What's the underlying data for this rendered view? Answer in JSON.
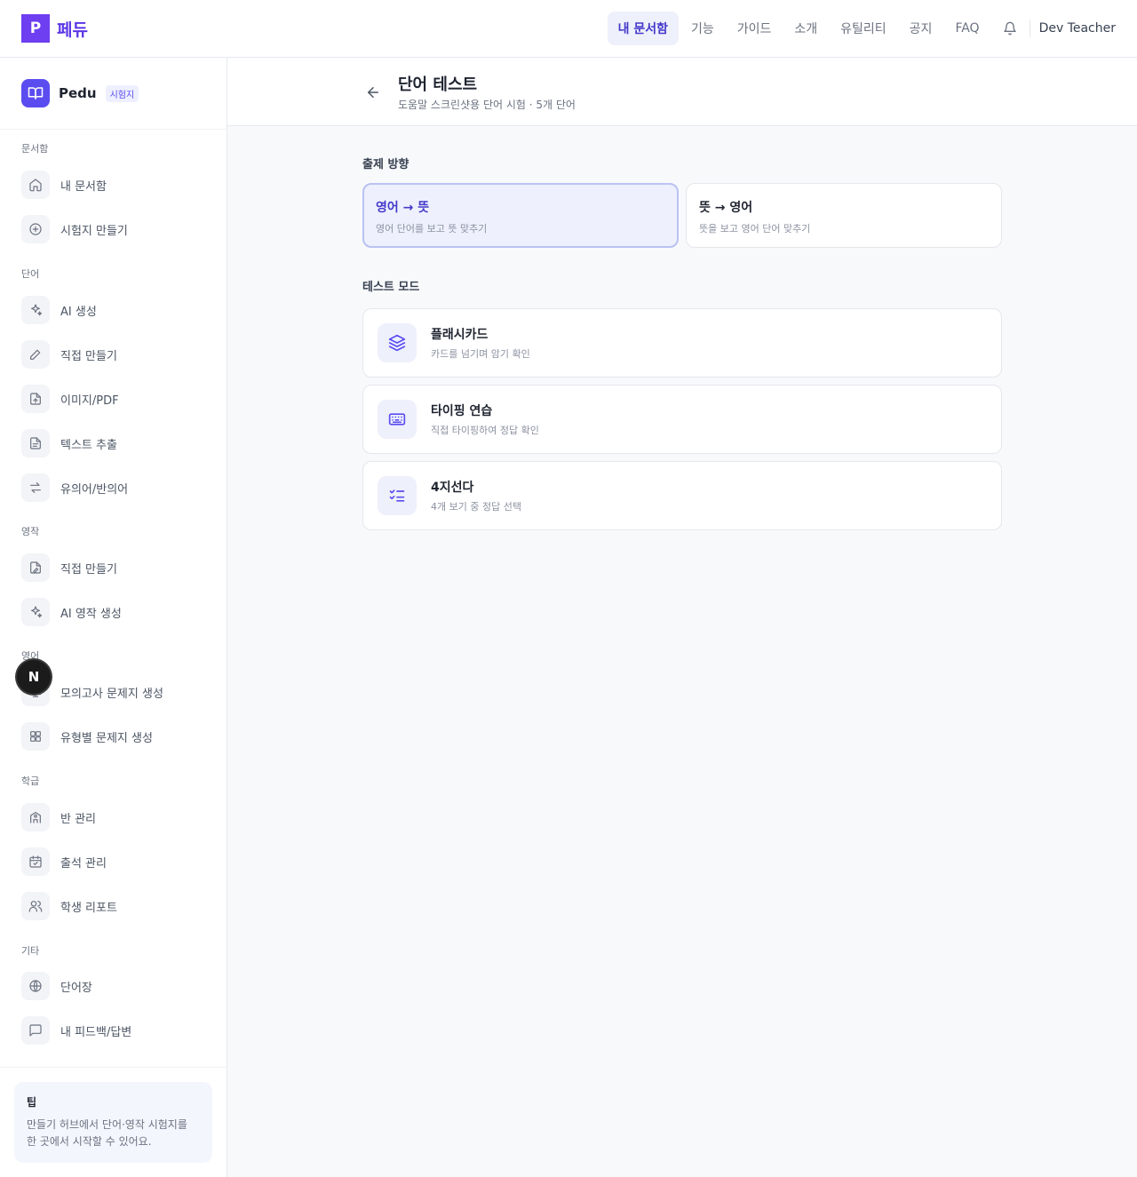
{
  "topbar": {
    "logo_letter": "P",
    "brand": "페듀",
    "nav": [
      "내 문서함",
      "기능",
      "가이드",
      "소개",
      "유틸리티",
      "공지",
      "FAQ"
    ],
    "user": "Dev Teacher"
  },
  "sidebar": {
    "brand_name": "Pedu",
    "brand_badge": "시험지",
    "sections": [
      {
        "title": "문서함",
        "items": [
          {
            "label": "내 문서함",
            "icon": "home-icon"
          },
          {
            "label": "시험지 만들기",
            "icon": "plus-circle-icon"
          }
        ]
      },
      {
        "title": "단어",
        "items": [
          {
            "label": "AI 생성",
            "icon": "sparkle-icon"
          },
          {
            "label": "직접 만들기",
            "icon": "pencil-icon"
          },
          {
            "label": "이미지/PDF",
            "icon": "file-upload-icon"
          },
          {
            "label": "텍스트 추출",
            "icon": "file-text-icon"
          },
          {
            "label": "유의어/반의어",
            "icon": "swap-icon"
          }
        ]
      },
      {
        "title": "영작",
        "items": [
          {
            "label": "직접 만들기",
            "icon": "file-edit-icon"
          },
          {
            "label": "AI 영작 생성",
            "icon": "sparkle-icon"
          }
        ]
      },
      {
        "title": "영어",
        "items": [
          {
            "label": "모의고사 문제지 생성",
            "icon": "monitor-icon"
          },
          {
            "label": "유형별 문제지 생성",
            "icon": "grid-icon"
          }
        ]
      },
      {
        "title": "학급",
        "items": [
          {
            "label": "반 관리",
            "icon": "school-icon"
          },
          {
            "label": "출석 관리",
            "icon": "calendar-check-icon"
          },
          {
            "label": "학생 리포트",
            "icon": "users-icon"
          }
        ]
      },
      {
        "title": "기타",
        "items": [
          {
            "label": "단어장",
            "icon": "globe-icon"
          },
          {
            "label": "내 피드백/답변",
            "icon": "message-icon"
          }
        ]
      }
    ],
    "tip": {
      "title": "팁",
      "body": "만들기 허브에서 단어·영작 시험지를 한 곳에서 시작할 수 있어요."
    },
    "float_letter": "N"
  },
  "header": {
    "title": "단어 테스트",
    "subtitle": "도움말 스크린샷용 단어 시험 · 5개 단어"
  },
  "direction": {
    "title": "출제 방향",
    "options": [
      {
        "title": "영어 → 뜻",
        "desc": "영어 단어를 보고 뜻 맞추기",
        "selected": true
      },
      {
        "title": "뜻 → 영어",
        "desc": "뜻을 보고 영어 단어 맞추기",
        "selected": false
      }
    ]
  },
  "modes": {
    "title": "테스트 모드",
    "items": [
      {
        "name": "플래시카드",
        "desc": "카드를 넘기며 암기 확인",
        "icon": "layers-icon"
      },
      {
        "name": "타이핑 연습",
        "desc": "직접 타이핑하여 정답 확인",
        "icon": "keyboard-icon"
      },
      {
        "name": "4지선다",
        "desc": "4개 보기 중 정답 선택",
        "icon": "list-check-icon"
      }
    ]
  },
  "colors": {
    "accent": "#5b4cf0",
    "brand": "#6d3ff0",
    "selected_bg": "#eef1fd"
  }
}
